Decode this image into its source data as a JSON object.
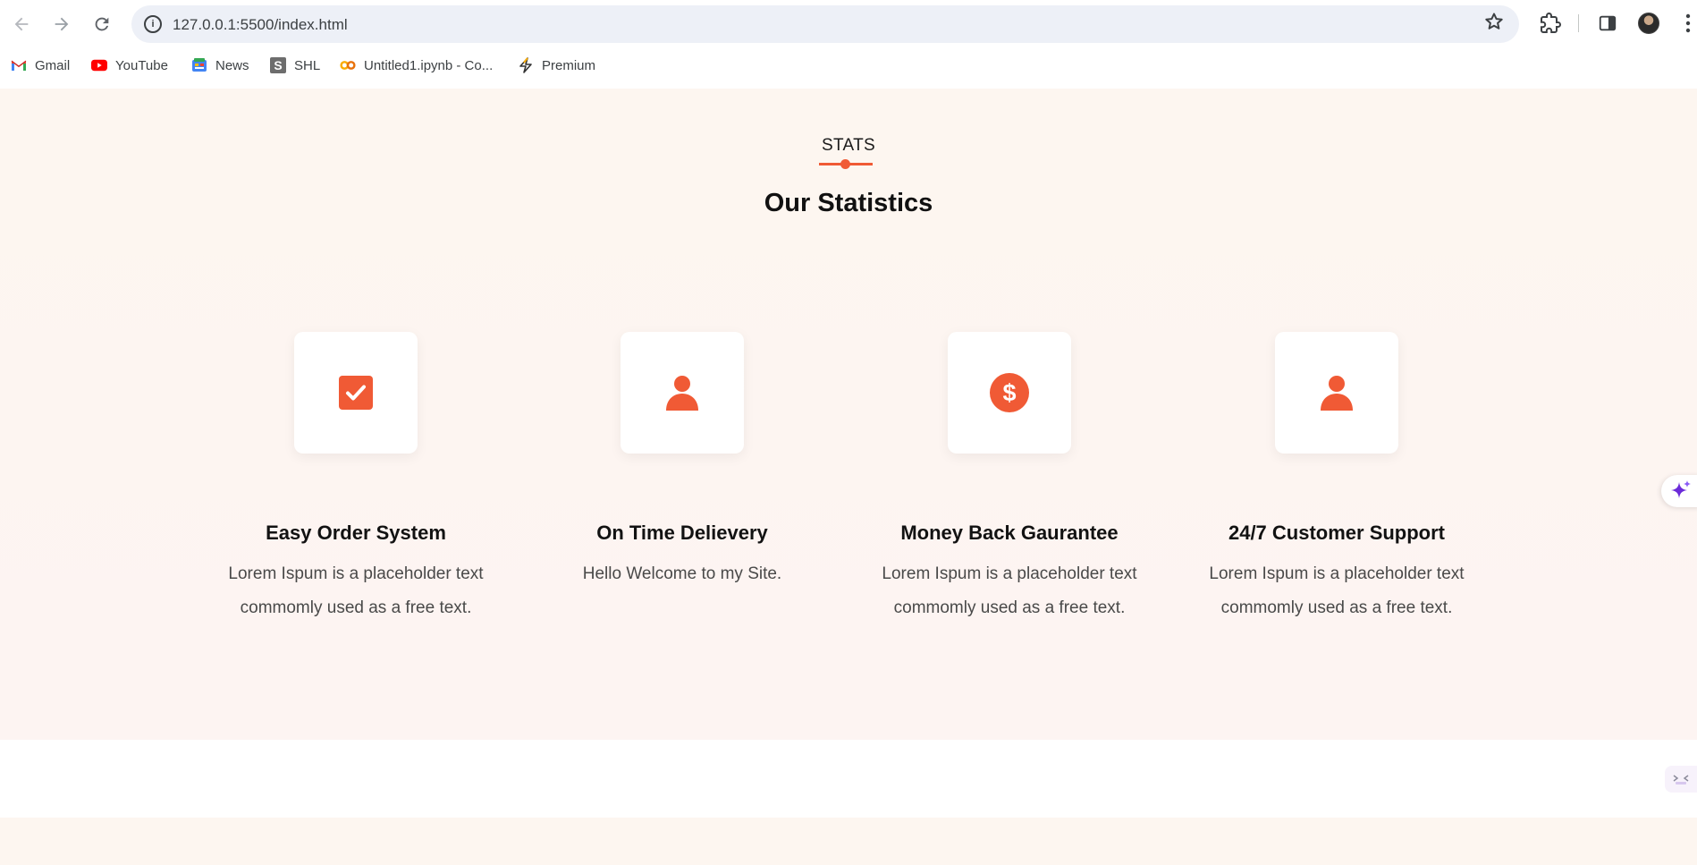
{
  "browser": {
    "url": "127.0.0.1:5500/index.html",
    "bookmarks": [
      {
        "label": "Gmail",
        "icon": "gmail-icon"
      },
      {
        "label": "YouTube",
        "icon": "youtube-icon"
      },
      {
        "label": "News",
        "icon": "news-icon"
      },
      {
        "label": "SHL",
        "icon": "shl-icon"
      },
      {
        "label": "Untitled1.ipynb - Co...",
        "icon": "colab-icon"
      },
      {
        "label": "Premium",
        "icon": "premium-icon"
      }
    ]
  },
  "stats": {
    "eyebrow": "STATS",
    "title": "Our Statistics",
    "accent_color": "#f05a35",
    "cards": [
      {
        "icon": "check-square-icon",
        "title": "Easy Order System",
        "desc": "Lorem Ispum is a placeholder text commomly used as a free text."
      },
      {
        "icon": "user-icon",
        "title": "On Time Delievery",
        "desc": "Hello Welcome to my Site."
      },
      {
        "icon": "dollar-circle-icon",
        "title": "Money Back Gaurantee",
        "desc": "Lorem Ispum is a placeholder text commomly used as a free text."
      },
      {
        "icon": "user-icon",
        "title": "24/7 Customer Support",
        "desc": "Lorem Ispum is a placeholder text commomly used as a free text."
      }
    ]
  }
}
